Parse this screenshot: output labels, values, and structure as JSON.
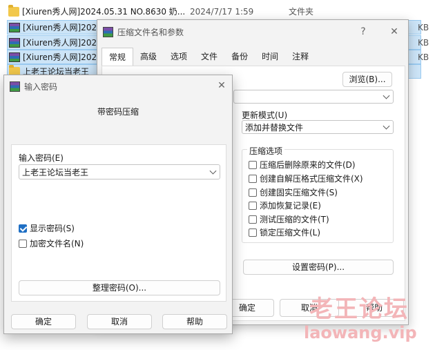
{
  "file_list": {
    "rows": [
      {
        "name": "[Xiuren秀人网]2024.05.31 NO.8630 奶...",
        "date": "2024/7/17 1:59",
        "type": "文件夹",
        "size": "",
        "icon": "folder-icon",
        "selected": false
      },
      {
        "name": "[Xiuren秀人网]2024",
        "date": "",
        "type": "",
        "size": "KB",
        "icon": "rar-icon",
        "selected": true
      },
      {
        "name": "[Xiuren秀人网]2024",
        "date": "",
        "type": "",
        "size": "KB",
        "icon": "rar-icon",
        "selected": true
      },
      {
        "name": "[Xiuren秀人网]2024",
        "date": "",
        "type": "",
        "size": "KB",
        "icon": "rar-icon",
        "selected": true
      },
      {
        "name": "上老王论坛当老王",
        "date": "",
        "type": "",
        "size": "",
        "icon": "folder-icon",
        "selected": true
      }
    ]
  },
  "archive_dialog": {
    "title": "压缩文件名和参数",
    "help": "?",
    "close": "✕",
    "tabs": [
      "常规",
      "高级",
      "选项",
      "文件",
      "备份",
      "时间",
      "注释"
    ],
    "active_tab": "常规",
    "browse_label": "浏览(B)...",
    "archive_name_value": "",
    "update_mode_label": "更新模式(U)",
    "update_mode_value": "添加并替换文件",
    "options_group_label": "压缩选项",
    "options": [
      {
        "label": "压缩后删除原来的文件(D)",
        "checked": false
      },
      {
        "label": "创建自解压格式压缩文件(X)",
        "checked": false
      },
      {
        "label": "创建固实压缩文件(S)",
        "checked": false
      },
      {
        "label": "添加恢复记录(E)",
        "checked": false
      },
      {
        "label": "测试压缩的文件(T)",
        "checked": false
      },
      {
        "label": "锁定压缩文件(L)",
        "checked": false
      }
    ],
    "set_password_label": "设置密码(P)...",
    "ok_label": "确定",
    "cancel_label": "取消",
    "help_label": "帮助"
  },
  "password_dialog": {
    "title": "输入密码",
    "close": "✕",
    "heading": "带密码压缩",
    "password_label": "输入密码(E)",
    "password_value": "上老王论坛当老王",
    "show_password_label": "显示密码(S)",
    "show_password_checked": true,
    "encrypt_names_label": "加密文件名(N)",
    "encrypt_names_checked": false,
    "organize_label": "整理密码(O)...",
    "ok_label": "确定",
    "cancel_label": "取消",
    "help_label": "帮助"
  },
  "watermark": {
    "text_cn": "老王论坛",
    "text_url": "laowang.vip",
    "color": "#f3b5b8"
  },
  "colors": {
    "selection": "#cce4f7",
    "accent": "#1f6fc4"
  }
}
